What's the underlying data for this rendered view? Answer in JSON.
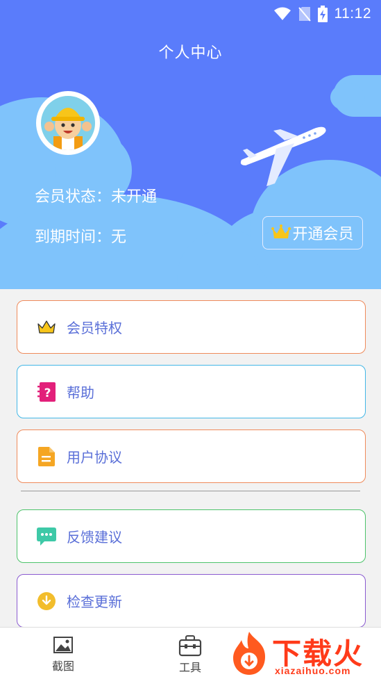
{
  "status_bar": {
    "time": "11:12"
  },
  "header": {
    "title": "个人中心",
    "member_status_label": "会员状态：",
    "member_status_value": "未开通",
    "expire_label": "到期时间：",
    "expire_value": "无",
    "open_vip_button": "开通会员"
  },
  "menu": [
    {
      "label": "会员特权",
      "icon": "crown-icon",
      "border": "#ef8a5a"
    },
    {
      "label": "帮助",
      "icon": "help-book-icon",
      "border": "#42b7e6"
    },
    {
      "label": "用户协议",
      "icon": "document-icon",
      "border": "#ef8a5a"
    },
    {
      "label": "反馈建议",
      "icon": "chat-icon",
      "border": "#4cc36a"
    },
    {
      "label": "检查更新",
      "icon": "download-icon",
      "border": "#8a5ad0"
    }
  ],
  "tabbar": {
    "tabs": [
      {
        "label": "截图",
        "icon": "image-icon"
      },
      {
        "label": "工具",
        "icon": "toolbox-icon"
      }
    ]
  },
  "watermark": {
    "brand": "下载火",
    "url": "xiazaihuo.com"
  }
}
